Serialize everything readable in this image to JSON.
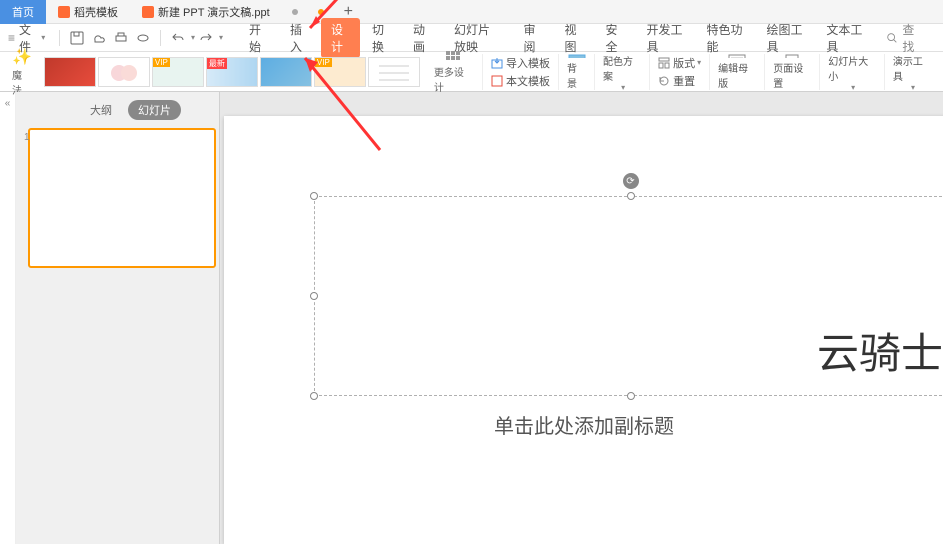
{
  "tabs": {
    "home": "首页",
    "docker": "稻壳模板",
    "file": "新建 PPT 演示文稿.ppt"
  },
  "toolbar": {
    "file_menu": "文件"
  },
  "menu": {
    "start": "开始",
    "insert": "插入",
    "design": "设计",
    "transition": "切换",
    "animation": "动画",
    "slideshow": "幻灯片放映",
    "review": "审阅",
    "view": "视图",
    "security": "安全",
    "devtools": "开发工具",
    "special": "特色功能",
    "drawing": "绘图工具",
    "texttools": "文本工具",
    "search": "查找"
  },
  "ribbon": {
    "magic": "魔法",
    "more_design": "更多设计",
    "import_template": "导入模板",
    "this_template": "本文模板",
    "background": "背景",
    "color_scheme": "配色方案",
    "layout": "版式",
    "reset": "重置",
    "edit_master": "编辑母版",
    "page_setup": "页面设置",
    "slide_size": "幻灯片大小",
    "presenter_tools": "演示工具"
  },
  "panel": {
    "outline": "大纲",
    "slides": "幻灯片",
    "num": "1"
  },
  "slide": {
    "title": "云骑士",
    "subtitle": "单击此处添加副标题"
  },
  "badges": {
    "vip": "VIP",
    "hot": "最新"
  }
}
